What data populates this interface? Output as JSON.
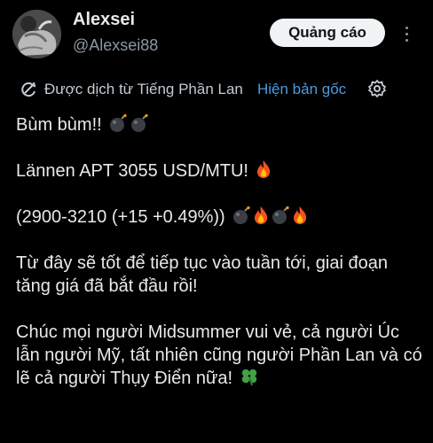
{
  "author": {
    "name": "Alexsei",
    "handle": "@Alexsei88",
    "avatar_icon": "bull-statue-avatar"
  },
  "header": {
    "ad_label": "Quảng cáo",
    "more_icon": "more-vertical-icon"
  },
  "translation": {
    "icon": "translate-icon",
    "label": "Được dịch từ Tiếng Phần Lan",
    "show_original": "Hiện bản gốc",
    "settings_icon": "settings-icon",
    "link_color": "#4c9be0"
  },
  "tweet": {
    "line1": "Bùm bùm!!",
    "line2": "Lännen APT 3055 USD/MTU!",
    "line3": "(2900-3210 (+15 +0.49%))",
    "line4": "Từ đây sẽ tốt để tiếp tục vào tuần tới, giai đoạn tăng giá đã bắt đầu rồi!",
    "line5": "Chúc mọi người Midsummer vui vẻ, cả người Úc lẫn người Mỹ, tất nhiên cũng người Phần Lan và có lẽ cả người Thụy Điển nữa!"
  },
  "colors": {
    "background": "#000000",
    "text": "#e7e9ea",
    "muted": "#8b98a5",
    "button_bg": "#eff3f4"
  }
}
